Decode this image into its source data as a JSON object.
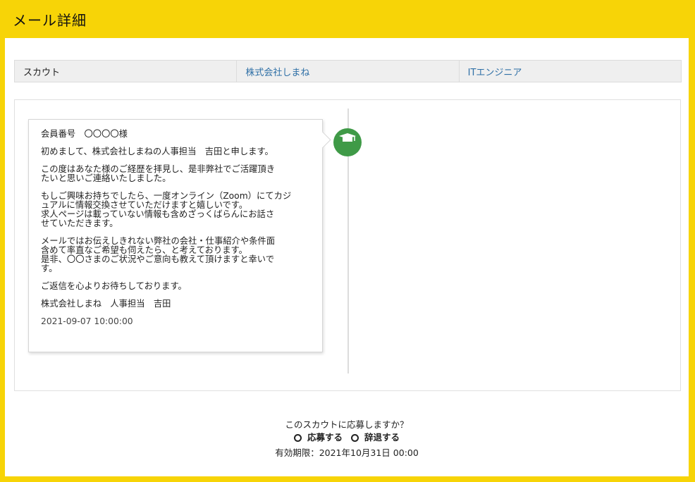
{
  "header": {
    "title": "メール詳細"
  },
  "info_bar": {
    "type": "スカウト",
    "company": "株式会社しまね",
    "position": "ITエンジニア"
  },
  "message": {
    "greeting": "会員番号　〇〇〇〇様",
    "intro": "初めまして、株式会社しまねの人事担当　吉田と申します。",
    "para1_line1": "この度はあなた様のご経歴を拝見し、是非弊社でご活躍頂き",
    "para1_line2": "たいと思いご連絡いたしました。",
    "para2_line1": "もしご興味お持ちでしたら、一度オンライン（Zoom）にてカジ",
    "para2_line2": "ュアルに情報交換させていただけますと嬉しいです。",
    "para2_line3": "求人ページは載っていない情報も含めざっくばらんにお話さ",
    "para2_line4": "せていただきます。",
    "para3_line1": "メールではお伝えしきれない弊社の会社・仕事紹介や条件面",
    "para3_line2": "含めて率直なご希望も伺えたら、と考えております。",
    "para3_line3": "是非、〇〇さまのご状況やご意向も教えて頂けますと幸いで",
    "para3_line4": "す。",
    "closing": "ご返信を心よりお待ちしております。",
    "signature": "株式会社しまね　人事担当　吉田",
    "timestamp": "2021-09-07 10:00:00"
  },
  "response": {
    "question": "このスカウトに応募しますか？",
    "apply_label": "応募する",
    "decline_label": "辞退する",
    "deadline": "有効期限：2021年10月31日 00:00"
  },
  "colors": {
    "frame": "#f7d407",
    "link": "#2e6fa6",
    "avatar": "#3f9a47"
  }
}
